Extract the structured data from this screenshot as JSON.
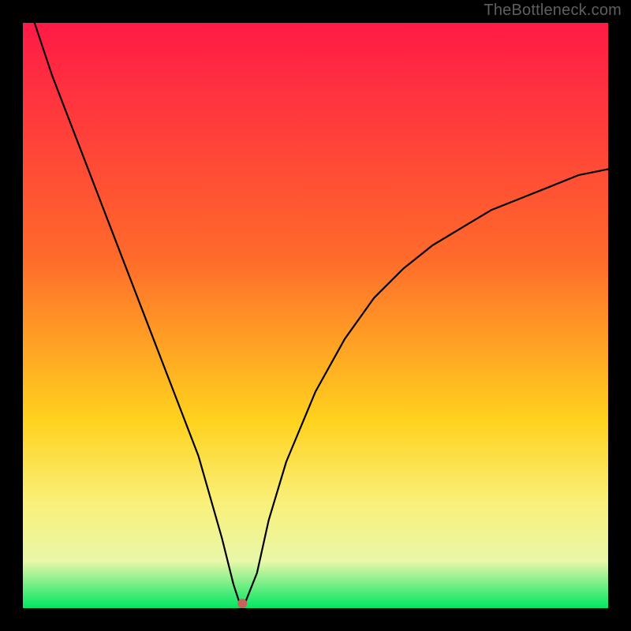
{
  "watermark": "TheBottleneck.com",
  "colors": {
    "black": "#000000",
    "curve": "#000000",
    "marker": "#c7615a",
    "gradient_top": "#ff1a47",
    "gradient_mid1": "#ff6a2b",
    "gradient_mid2": "#ffd21e",
    "gradient_mid3": "#f9f07a",
    "gradient_mid4": "#e9f7a8",
    "gradient_bottom": "#00e663"
  },
  "chart_data": {
    "type": "line",
    "title": "",
    "xlabel": "",
    "ylabel": "",
    "xlim": [
      0,
      100
    ],
    "ylim": [
      0,
      100
    ],
    "grid": false,
    "legend": false,
    "series": [
      {
        "name": "bottleneck-curve",
        "x": [
          2,
          5,
          10,
          15,
          20,
          25,
          30,
          34,
          36,
          37,
          38,
          40,
          42,
          45,
          50,
          55,
          60,
          65,
          70,
          75,
          80,
          85,
          90,
          95,
          100
        ],
        "y": [
          100,
          91,
          78,
          65,
          52,
          39,
          26,
          12,
          4,
          1,
          1,
          6,
          15,
          25,
          37,
          46,
          53,
          58,
          62,
          65,
          68,
          70,
          72,
          74,
          75
        ]
      }
    ],
    "annotations": [
      {
        "name": "min-marker",
        "x": 37.5,
        "y": 0.8
      }
    ],
    "background_gradient": {
      "direction": "vertical",
      "stops": [
        {
          "pos": 0.0,
          "color": "#ff1a47"
        },
        {
          "pos": 0.4,
          "color": "#ff6a2b"
        },
        {
          "pos": 0.68,
          "color": "#ffd21e"
        },
        {
          "pos": 0.82,
          "color": "#f9f07a"
        },
        {
          "pos": 0.92,
          "color": "#e9f7a8"
        },
        {
          "pos": 1.0,
          "color": "#00e663"
        }
      ]
    }
  }
}
